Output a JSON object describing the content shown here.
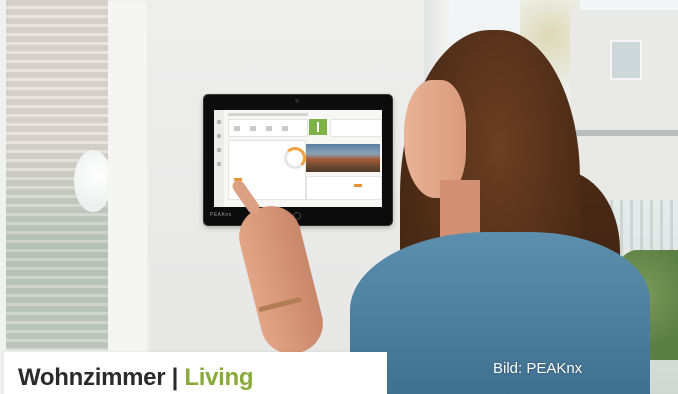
{
  "caption": {
    "title_main": "Wohnzimmer | ",
    "title_accent": "Living",
    "accent_color": "#8aaa3b"
  },
  "credit": "Bild: PEAKnx",
  "device": {
    "brand": "PEAKnx"
  }
}
